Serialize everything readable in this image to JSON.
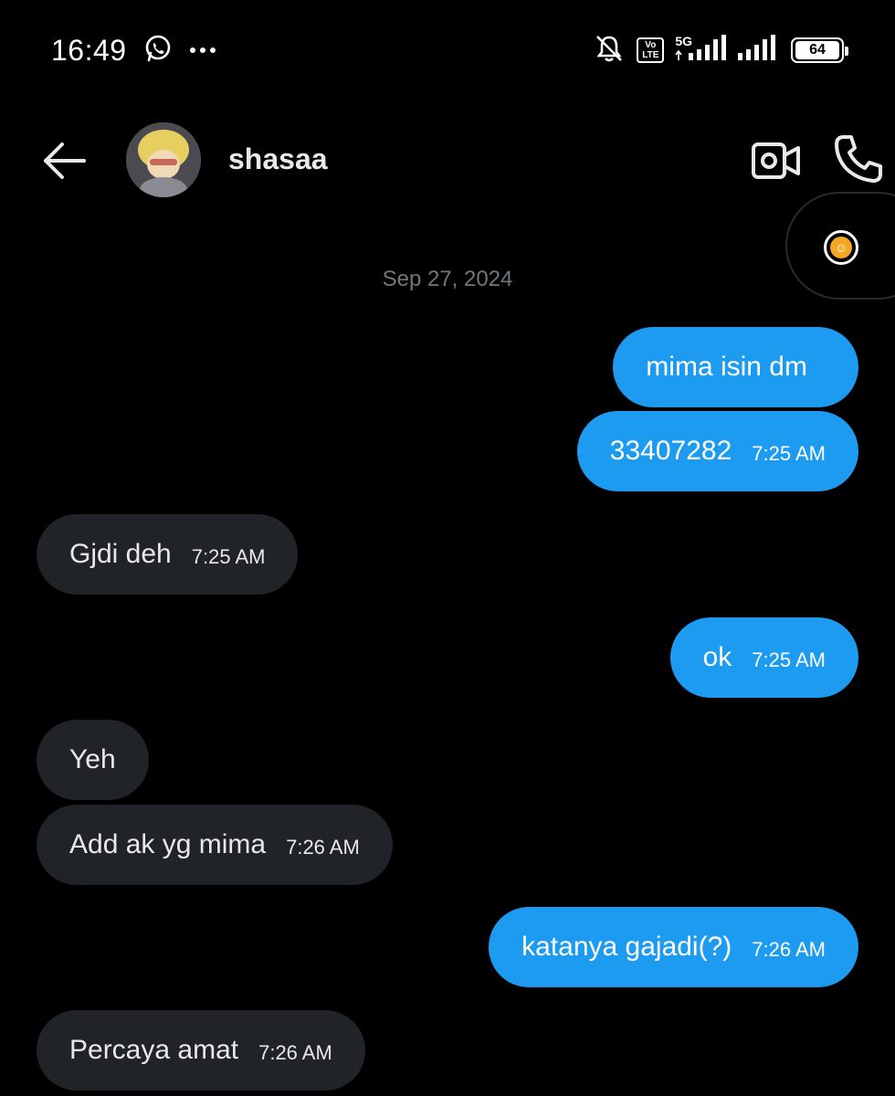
{
  "status_bar": {
    "time": "16:49",
    "notification_icons": [
      "whatsapp-icon",
      "more-dots-icon"
    ],
    "network_label": "5G",
    "volte_label": "Vo\nLTE",
    "battery_level": "64"
  },
  "header": {
    "username": "shasaa"
  },
  "date_divider": "Sep 27, 2024",
  "messages": [
    {
      "direction": "out",
      "text": "mima isin dm",
      "time": ""
    },
    {
      "direction": "out",
      "text": "33407282",
      "time": "7:25 AM"
    },
    {
      "direction": "in",
      "text": "Gjdi deh",
      "time": "7:25 AM"
    },
    {
      "direction": "out",
      "text": "ok",
      "time": "7:25 AM"
    },
    {
      "direction": "in",
      "text": "Yeh",
      "time": ""
    },
    {
      "direction": "in",
      "text": "Add ak yg mima",
      "time": "7:26 AM"
    },
    {
      "direction": "out",
      "text": "katanya gajadi(?)",
      "time": "7:26 AM"
    },
    {
      "direction": "in",
      "text": "Percaya amat",
      "time": "7:26 AM"
    }
  ],
  "colors": {
    "background": "#000000",
    "outgoing_bubble": "#1d9bf0",
    "incoming_bubble": "#202327",
    "secondary_text": "#71767b"
  }
}
